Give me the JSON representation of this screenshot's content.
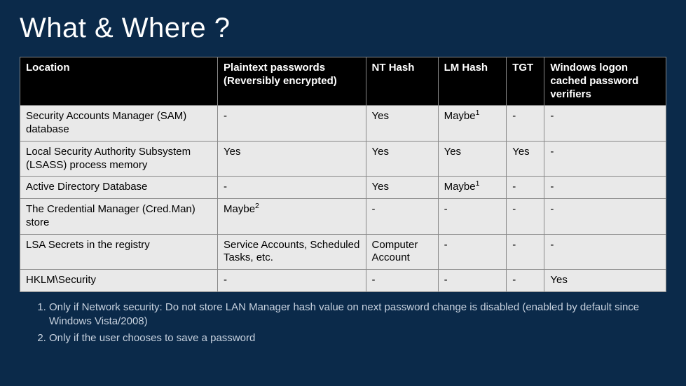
{
  "title": "What & Where ?",
  "headers": {
    "c1": "Location",
    "c2": "Plaintext passwords (Reversibly encrypted)",
    "c3": "NT Hash",
    "c4": "LM Hash",
    "c5": "TGT",
    "c6": "Windows logon cached password verifiers"
  },
  "rows": [
    {
      "loc": "Security Accounts Manager (SAM) database",
      "pt": "-",
      "nt": "Yes",
      "lm": "Maybe",
      "lm_sup": "1",
      "tgt": "-",
      "ver": "-"
    },
    {
      "loc": "Local Security Authority Subsystem (LSASS) process memory",
      "pt": "Yes",
      "nt": "Yes",
      "lm": "Yes",
      "lm_sup": "",
      "tgt": "Yes",
      "ver": "-"
    },
    {
      "loc": "Active Directory Database",
      "pt": "-",
      "nt": "Yes",
      "lm": "Maybe",
      "lm_sup": "1",
      "tgt": "-",
      "ver": "-"
    },
    {
      "loc": "The Credential Manager (Cred.Man) store",
      "pt": "Maybe",
      "pt_sup": "2",
      "nt": "-",
      "lm": "-",
      "lm_sup": "",
      "tgt": "-",
      "ver": "-"
    },
    {
      "loc": "LSA Secrets in the registry",
      "pt": "Service Accounts, Scheduled Tasks, etc.",
      "nt": "Computer Account",
      "lm": "-",
      "lm_sup": "",
      "tgt": "-",
      "ver": "-"
    },
    {
      "loc": "HKLM\\Security",
      "pt": "-",
      "nt": "-",
      "lm": "-",
      "lm_sup": "",
      "tgt": "-",
      "ver": "Yes"
    }
  ],
  "footnotes": {
    "f1": "Only if Network security: Do not store LAN Manager hash value on next password change is disabled (enabled by default since Windows Vista/2008)",
    "f2": "Only if the user chooses to save a password"
  }
}
